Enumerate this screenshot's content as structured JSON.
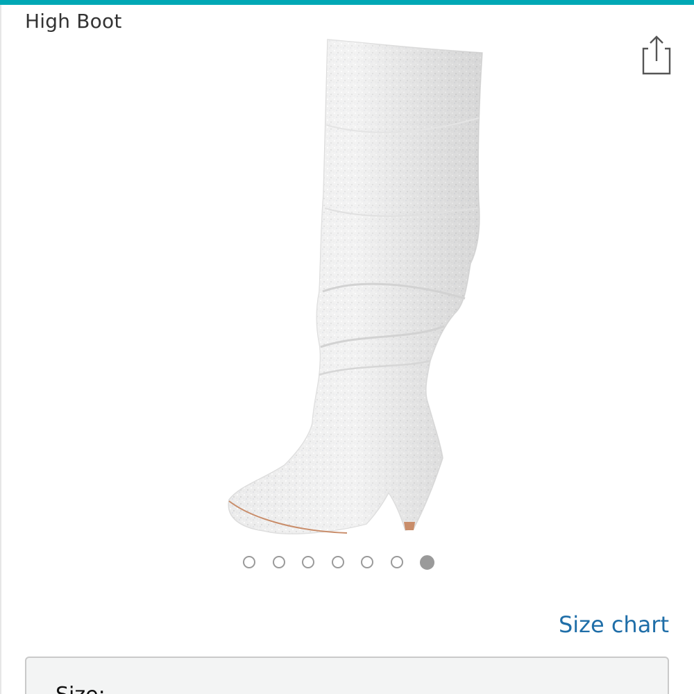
{
  "header": {
    "title": "High Boot",
    "accent_color": "#00a8b5"
  },
  "product": {
    "image_icon": "boot-icon",
    "share_icon": "share-icon"
  },
  "carousel": {
    "total": 7,
    "active_index": 6
  },
  "links": {
    "size_chart": "Size chart",
    "link_color": "#1f6ea8"
  },
  "size_selector": {
    "label": "Size:"
  }
}
